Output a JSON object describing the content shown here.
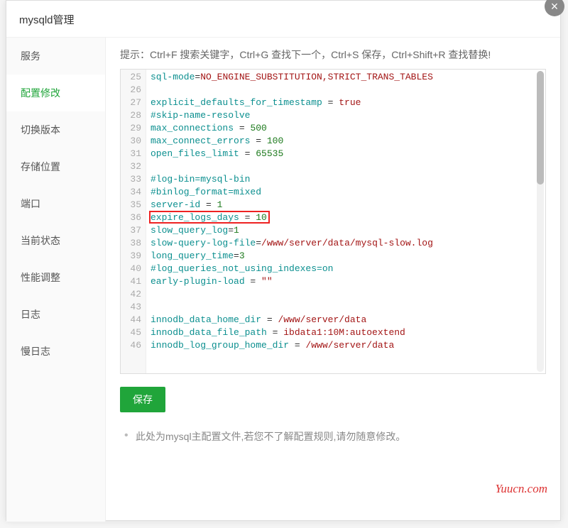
{
  "dialog": {
    "title": "mysqld管理",
    "close_label": "×"
  },
  "sidebar": {
    "items": [
      {
        "label": "服务",
        "active": false
      },
      {
        "label": "配置修改",
        "active": true
      },
      {
        "label": "切换版本",
        "active": false
      },
      {
        "label": "存储位置",
        "active": false
      },
      {
        "label": "端口",
        "active": false
      },
      {
        "label": "当前状态",
        "active": false
      },
      {
        "label": "性能调整",
        "active": false
      },
      {
        "label": "日志",
        "active": false
      },
      {
        "label": "慢日志",
        "active": false
      }
    ]
  },
  "main": {
    "hint": "提示：Ctrl+F 搜索关键字，Ctrl+G 查找下一个，Ctrl+S 保存，Ctrl+Shift+R 查找替换!",
    "save_label": "保存",
    "note": "此处为mysql主配置文件,若您不了解配置规则,请勿随意修改。",
    "watermark": "Yuucn.com"
  },
  "editor": {
    "first_line_no": 25,
    "highlight_line_no": 36,
    "lines": [
      {
        "key": "sql-mode",
        "op": "=",
        "val": "NO_ENGINE_SUBSTITUTION,STRICT_TRANS_TABLES"
      },
      {
        "blank": true
      },
      {
        "key": "explicit_defaults_for_timestamp",
        "op": " = ",
        "val": "true"
      },
      {
        "com": "#skip-name-resolve"
      },
      {
        "key": "max_connections",
        "op": " = ",
        "num": "500"
      },
      {
        "key": "max_connect_errors",
        "op": " = ",
        "num": "100"
      },
      {
        "key": "open_files_limit",
        "op": " = ",
        "num": "65535"
      },
      {
        "blank": true
      },
      {
        "com": "#log-bin=mysql-bin"
      },
      {
        "com": "#binlog_format=mixed"
      },
      {
        "key": "server-id",
        "op": " = ",
        "num": "1"
      },
      {
        "key": "expire_logs_days",
        "op": " = ",
        "num": "10"
      },
      {
        "key": "slow_query_log",
        "op": "=",
        "num": "1"
      },
      {
        "key": "slow-query-log-file",
        "op": "=",
        "val": "/www/server/data/mysql-slow.log"
      },
      {
        "key": "long_query_time",
        "op": "=",
        "num": "3"
      },
      {
        "com": "#log_queries_not_using_indexes=on"
      },
      {
        "key": "early-plugin-load",
        "op": " = ",
        "val": "\"\""
      },
      {
        "blank": true
      },
      {
        "blank": true
      },
      {
        "key": "innodb_data_home_dir",
        "op": " = ",
        "val": "/www/server/data"
      },
      {
        "key": "innodb_data_file_path",
        "op": " = ",
        "val": "ibdata1:10M:autoextend"
      },
      {
        "key": "innodb_log_group_home_dir",
        "op": " = ",
        "val": "/www/server/data"
      }
    ]
  }
}
